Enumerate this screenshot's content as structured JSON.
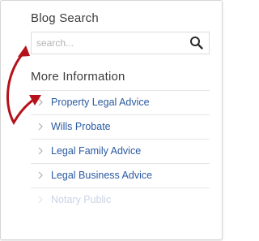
{
  "blog_search": {
    "title": "Blog Search",
    "input_value": "",
    "placeholder": "search...",
    "button_icon": "search-icon"
  },
  "more_information": {
    "title": "More Information",
    "items": [
      {
        "label": "Property Legal Advice",
        "icon": "chevron-right-icon"
      },
      {
        "label": "Wills Probate",
        "icon": "chevron-right-icon"
      },
      {
        "label": "Legal Family Advice",
        "icon": "chevron-right-icon"
      },
      {
        "label": "Legal Business Advice",
        "icon": "chevron-right-icon"
      },
      {
        "label": "Notary Public",
        "icon": "chevron-right-icon"
      }
    ]
  },
  "annotation": {
    "icon": "double-headed-arrow-icon",
    "color": "#b5121b"
  },
  "colors": {
    "link": "#2a5aa0",
    "heading": "#3d3d3d",
    "border": "#dcdcdc"
  }
}
